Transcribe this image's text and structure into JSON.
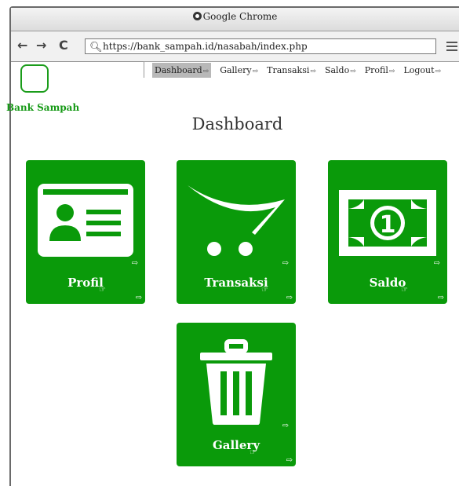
{
  "window": {
    "title": "Google Chrome"
  },
  "browser": {
    "back_glyph": "←",
    "forward_glyph": "→",
    "reload_glyph": "C",
    "url": "https://bank_sampah.id/nasabah/index.php"
  },
  "brand": {
    "name": "Bank Sampah",
    "accent_color": "#0a9a0a"
  },
  "menu": {
    "items": [
      {
        "label": "Dashboard"
      },
      {
        "label": "Gallery"
      },
      {
        "label": "Transaksi"
      },
      {
        "label": "Saldo"
      },
      {
        "label": "Profil"
      },
      {
        "label": "Logout"
      }
    ],
    "active": "Dashboard"
  },
  "page": {
    "title": "Dashboard"
  },
  "tiles": [
    {
      "label": "Profil",
      "icon": "id-card-icon"
    },
    {
      "label": "Transaksi",
      "icon": "cart-icon"
    },
    {
      "label": "Saldo",
      "icon": "money-icon"
    },
    {
      "label": "Gallery",
      "icon": "trash-icon"
    }
  ]
}
